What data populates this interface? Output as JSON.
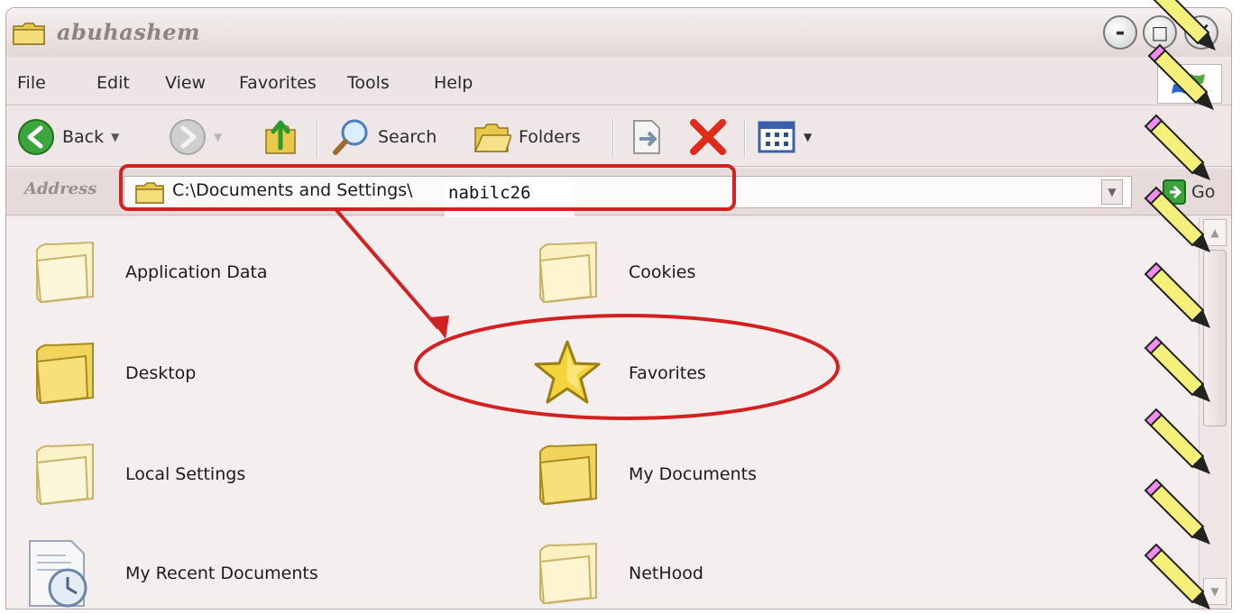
{
  "window": {
    "title": "abuhashem",
    "controls": {
      "minimize": "-",
      "maximize": "□",
      "close": "✕"
    }
  },
  "menu": [
    {
      "label": "File"
    },
    {
      "label": "Edit"
    },
    {
      "label": "View"
    },
    {
      "label": "Favorites"
    },
    {
      "label": "Tools"
    },
    {
      "label": "Help"
    }
  ],
  "toolbar": {
    "back_label": "Back",
    "search_label": "Search",
    "folders_label": "Folders"
  },
  "address": {
    "label": "Address",
    "path": "C:\\Documents and Settings\\",
    "user": "nabilc26",
    "go_label": "Go"
  },
  "items": [
    {
      "label": "Application Data",
      "icon": "folder-icon"
    },
    {
      "label": "Cookies",
      "icon": "folder-icon"
    },
    {
      "label": "Desktop",
      "icon": "folder-icon"
    },
    {
      "label": "Favorites",
      "icon": "star-icon"
    },
    {
      "label": "Local Settings",
      "icon": "folder-icon"
    },
    {
      "label": "My Documents",
      "icon": "folder-icon"
    },
    {
      "label": "My Recent Documents",
      "icon": "recent-documents-icon"
    },
    {
      "label": "NetHood",
      "icon": "folder-icon"
    }
  ],
  "colors": {
    "annotation": "#d32020",
    "pencil_body": "#f5f07a",
    "pencil_eraser": "#f28cf0"
  }
}
